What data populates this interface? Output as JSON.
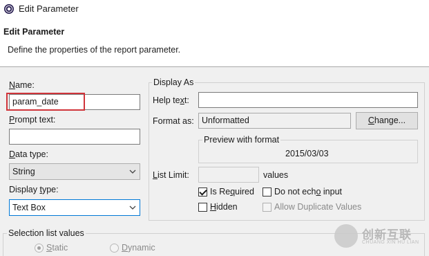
{
  "window": {
    "title": "Edit Parameter",
    "icon": "eclipse-icon"
  },
  "header": {
    "title": "Edit Parameter",
    "description": "Define the properties of the report parameter."
  },
  "left": {
    "name_label_prefix": "N",
    "name_label_rest": "ame:",
    "name_value": "param_date",
    "prompt_label_prefix": "P",
    "prompt_label_rest": "rompt text:",
    "prompt_value": "",
    "data_type_label_prefix": "D",
    "data_type_label_rest": "ata type:",
    "data_type_value": "String",
    "display_type_label_pre": "Display ",
    "display_type_label_ul": "t",
    "display_type_label_rest": "ype:",
    "display_type_value": "Text Box"
  },
  "display_as": {
    "group_title": "Display As",
    "help_text_label_pre": "Help te",
    "help_text_label_ul": "x",
    "help_text_label_rest": "t:",
    "help_text_value": "",
    "format_label": "Format as:",
    "format_value": "Unformatted",
    "change_button": "Change...",
    "change_button_ul": "C",
    "change_button_rest": "hange...",
    "preview_title": "Preview with format",
    "preview_value": "2015/03/03",
    "list_limit_label_prefix": "L",
    "list_limit_label_rest": "ist Limit:",
    "list_limit_value": "",
    "list_limit_unit": "values",
    "is_required_pre": "Is Re",
    "is_required_ul": "q",
    "is_required_rest": "uired",
    "is_required_checked": true,
    "do_not_echo_pre": "Do not ech",
    "do_not_echo_ul": "o",
    "do_not_echo_rest": " input",
    "do_not_echo_checked": false,
    "hidden_prefix": "H",
    "hidden_rest": "idden",
    "hidden_checked": false,
    "allow_duplicates": "Allow Duplicate Values",
    "allow_duplicates_checked": false
  },
  "selection": {
    "group_title": "Selection list values",
    "static_prefix": "S",
    "static_rest": "tatic",
    "dynamic_prefix": "D",
    "dynamic_rest": "ynamic",
    "selected": "Static"
  },
  "watermark": {
    "text": "创新互联",
    "sub": "CHUANG XIN HU LIAN"
  }
}
